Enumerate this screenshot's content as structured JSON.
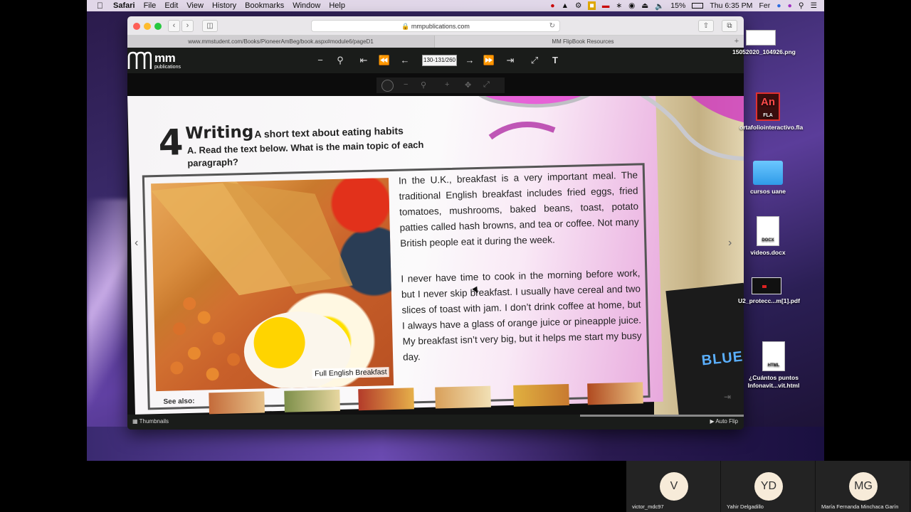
{
  "menubar": {
    "app": "Safari",
    "items": [
      "File",
      "Edit",
      "View",
      "History",
      "Bookmarks",
      "Window",
      "Help"
    ],
    "battery": "15%",
    "clock": "Thu 6:35 PM",
    "user": "Fer"
  },
  "browser": {
    "address": "mmpublications.com",
    "tabs": [
      {
        "label": "www.mmstudent.com/Books/PioneerAmBeg/book.aspx#module6/pageD1"
      },
      {
        "label": "MM FlipBook Resources"
      }
    ]
  },
  "flipbook": {
    "logo_main": "mm",
    "logo_sub": "publications",
    "page_indicator": "130-131/260",
    "bottom": {
      "thumbnails": "Thumbnails",
      "auto_flip": "Auto Flip"
    }
  },
  "book_page": {
    "number": "4",
    "title": "Writing",
    "subtitle": "A short text about eating habits",
    "instruction": "A. Read the text below. What is the main topic of each paragraph?",
    "photo_caption": "Full English Breakfast",
    "paragraph1": "In the U.K., breakfast is a very important meal. The traditional English breakfast includes fried eggs, fried tomatoes, mushrooms, baked beans, toast, potato patties called hash browns, and tea or coffee. Not many British people eat it during the week.",
    "paragraph2": "I never have time to cook in the morning before work, but I never skip breakfast. I usually have cereal and two slices of toast with jam. I don’t drink coffee at home, but I always have a glass of orange juice or pineapple juice. My breakfast isn’t very big, but it helps me start my busy day.",
    "see_also": "See also:",
    "blue_book_text": "BLUE"
  },
  "desktop": {
    "icons": [
      {
        "label": "15052020_104926.png",
        "icon": "image-file-icon"
      },
      {
        "label": "ortafoliointeractivo.fla",
        "icon": "animate-file-icon",
        "glyph": "An",
        "sub": "FLA"
      },
      {
        "label": "cursos uane",
        "icon": "folder-icon"
      },
      {
        "label": "videos.docx",
        "icon": "docx-file-icon",
        "sub": "DOCX"
      },
      {
        "label": "U2_protecc...m[1].pdf",
        "icon": "pdf-file-icon"
      },
      {
        "label": "¿Cuántos puntos Infonavit...vit.html",
        "icon": "html-file-icon",
        "sub": "HTML"
      }
    ]
  },
  "participants": [
    {
      "initials": "V",
      "name": "victor_mdc97"
    },
    {
      "initials": "YD",
      "name": "Yahir Delgadillo"
    },
    {
      "initials": "MG",
      "name": "María Fernanda Minchaca Garín"
    }
  ],
  "colors": {
    "flipbook_bar": "#1a1c1a",
    "page_bg": "#f6f4f6",
    "avatar_bg": "#f7ebd9",
    "glasses_pink": "#e23fd0"
  }
}
